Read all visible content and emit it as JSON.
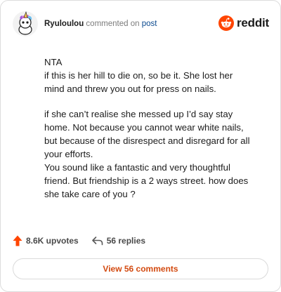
{
  "header": {
    "username": "Ryuloulou",
    "action_text": "commented on",
    "post_link": "post",
    "brand_name": "reddit",
    "brand_color": "#ff4500",
    "avatar_icon": "snoo-unicorn-avatar"
  },
  "comment": {
    "paragraphs": [
      [
        "NTA",
        "if this is her hill to die on, so be it. She lost her mind and threw you out for press on nails."
      ],
      [
        "if she can’t realise she messed up I’d say stay home. Not because you cannot wear white nails, but because of the disrespect and disregard for all your efforts.",
        "You sound like a fantastic and very thoughtful friend. But friendship is a 2 ways street. how does she take care of you ?"
      ]
    ]
  },
  "footer": {
    "upvotes": "8.6K upvotes",
    "upvote_icon": "upvote-arrow-icon",
    "upvote_color": "#ff4500",
    "replies": "56 replies",
    "reply_icon": "reply-arrow-icon",
    "view_button": "View 56 comments",
    "view_button_color": "#d34a10"
  }
}
